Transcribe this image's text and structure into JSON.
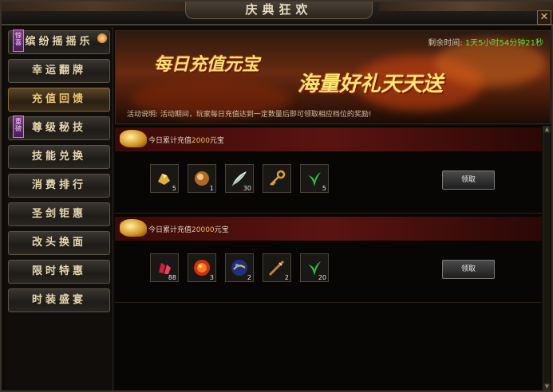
{
  "window": {
    "title": "庆典狂欢",
    "close_glyph": "✕"
  },
  "sidebar": {
    "items": [
      {
        "label": "缤纷摇摇乐",
        "tag": "",
        "active": false,
        "dot": true
      },
      {
        "label": "幸运翻牌",
        "tag": "",
        "active": false
      },
      {
        "label": "充值回馈",
        "tag": "",
        "active": true
      },
      {
        "label": "尊级秘技",
        "tag": "重磅",
        "active": false
      },
      {
        "label": "技能兑换",
        "tag": "",
        "active": false
      },
      {
        "label": "消费排行",
        "tag": "",
        "active": false
      },
      {
        "label": "圣剑钜惠",
        "tag": "",
        "active": false
      },
      {
        "label": "改头换面",
        "tag": "",
        "active": false
      },
      {
        "label": "限时特惠",
        "tag": "",
        "active": false
      },
      {
        "label": "时装盛宴",
        "tag": "",
        "active": false
      }
    ],
    "first_tag": "惊喜"
  },
  "banner": {
    "headline_1": "每日充值元宝",
    "headline_2": "海量好礼天天送",
    "timer_label": "剩余时间:",
    "timer_value": "1天5小时54分钟21秒",
    "description": "活动说明:  活动期间，玩家每日充值达到一定数量后即可领取相应档位的奖励!"
  },
  "rewards": [
    {
      "title_prefix": "今日累计充值",
      "amount": "2000",
      "title_suffix": "元宝",
      "claim_label": "领取",
      "items": [
        {
          "icon": "gold-ore-icon",
          "count": "5"
        },
        {
          "icon": "orb-icon",
          "count": "1"
        },
        {
          "icon": "feather-icon",
          "count": "30"
        },
        {
          "icon": "key-icon",
          "count": ""
        },
        {
          "icon": "herb-icon",
          "count": "5"
        }
      ]
    },
    {
      "title_prefix": "今日累计充值",
      "amount": "20000",
      "title_suffix": "元宝",
      "claim_label": "领取",
      "items": [
        {
          "icon": "red-crystal-icon",
          "count": "88"
        },
        {
          "icon": "fire-orb-icon",
          "count": "3"
        },
        {
          "icon": "blue-orb-icon",
          "count": "2"
        },
        {
          "icon": "weapon-icon",
          "count": "2"
        },
        {
          "icon": "herb-icon",
          "count": "20"
        }
      ]
    }
  ],
  "colors": {
    "accent_gold": "#f0c040",
    "timer_green": "#60e040",
    "header_red": "#5a1410"
  }
}
